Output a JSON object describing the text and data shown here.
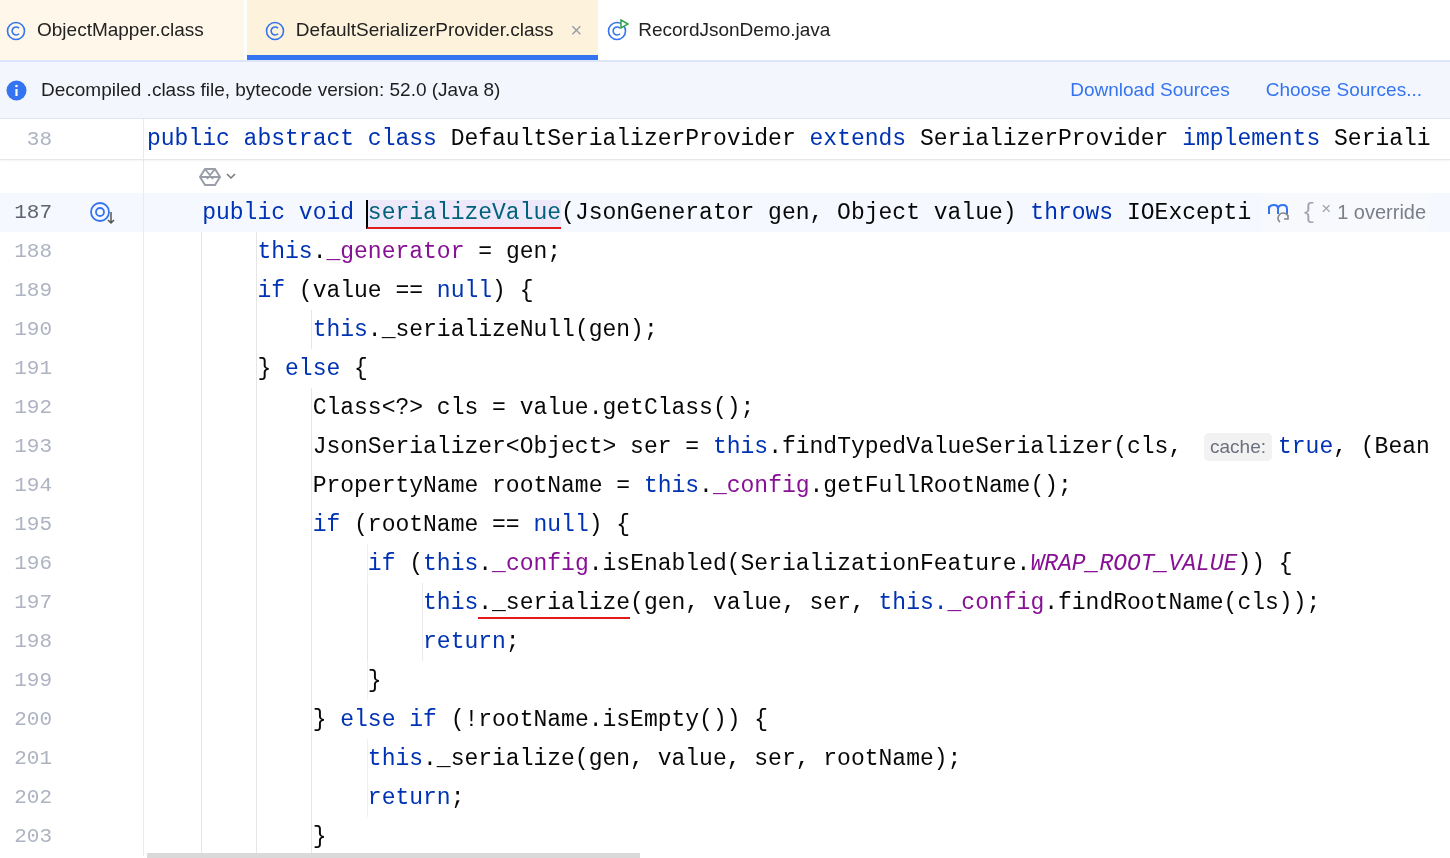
{
  "tabs": [
    {
      "label": "ObjectMapper.class",
      "kind": "class",
      "selected": false
    },
    {
      "label": "DefaultSerializerProvider.class",
      "kind": "class",
      "selected": true,
      "close": "×"
    },
    {
      "label": "RecordJsonDemo.java",
      "kind": "java",
      "selected": false
    }
  ],
  "banner": {
    "message": "Decompiled .class file, bytecode version: 52.0 (Java 8)",
    "links": [
      "Download Sources",
      "Choose Sources..."
    ]
  },
  "editor": {
    "sticky_line": {
      "number": "38",
      "tokens": [
        {
          "kind": "kw",
          "text": "public abstract class"
        },
        {
          "kind": "plain",
          "text": " DefaultSerializerProvider "
        },
        {
          "kind": "kw",
          "text": "extends"
        },
        {
          "kind": "plain",
          "text": " SerializerProvider "
        },
        {
          "kind": "kw",
          "text": "implements"
        },
        {
          "kind": "plain",
          "text": " Seriali"
        }
      ]
    },
    "lines": [
      {
        "number": "187",
        "current": true,
        "override_marker": true,
        "tokens": [
          {
            "kind": "kw",
            "text": "    public void "
          },
          {
            "kind": "method",
            "text": "serializeValue",
            "highlighted": true,
            "caret": true,
            "underlined": true
          },
          {
            "kind": "plain",
            "text": "(JsonGenerator gen, Object value) "
          },
          {
            "kind": "kw",
            "text": "throws"
          },
          {
            "kind": "plain",
            "text": " IOExcepti"
          }
        ],
        "inlay": {
          "brace": "{",
          "close": "×",
          "text": "1 override"
        }
      },
      {
        "number": "188",
        "current": false,
        "tokens": [
          {
            "kind": "kw",
            "text": "        this"
          },
          {
            "kind": "plain",
            "text": "."
          },
          {
            "kind": "field",
            "text": "_generator"
          },
          {
            "kind": "plain",
            "text": " = gen;"
          }
        ]
      },
      {
        "number": "189",
        "current": false,
        "tokens": [
          {
            "kind": "kw",
            "text": "        if"
          },
          {
            "kind": "plain",
            "text": " (value == "
          },
          {
            "kind": "kw",
            "text": "null"
          },
          {
            "kind": "plain",
            "text": ") {"
          }
        ]
      },
      {
        "number": "190",
        "current": false,
        "tokens": [
          {
            "kind": "kw",
            "text": "            this"
          },
          {
            "kind": "plain",
            "text": "._serializeNull(gen);"
          }
        ]
      },
      {
        "number": "191",
        "current": false,
        "tokens": [
          {
            "kind": "plain",
            "text": "        } "
          },
          {
            "kind": "kw",
            "text": "else"
          },
          {
            "kind": "plain",
            "text": " {"
          }
        ]
      },
      {
        "number": "192",
        "current": false,
        "tokens": [
          {
            "kind": "plain",
            "text": "            Class<?> cls = value.getClass();"
          }
        ]
      },
      {
        "number": "193",
        "current": false,
        "tokens": [
          {
            "kind": "plain",
            "text": "            JsonSerializer<Object> ser = "
          },
          {
            "kind": "kw",
            "text": "this"
          },
          {
            "kind": "plain",
            "text": ".findTypedValueSerializer(cls, "
          },
          {
            "kind": "hint",
            "text": "cache:"
          },
          {
            "kind": "kw",
            "text": "true"
          },
          {
            "kind": "plain",
            "text": ", (Bean"
          }
        ]
      },
      {
        "number": "194",
        "current": false,
        "tokens": [
          {
            "kind": "plain",
            "text": "            PropertyName rootName = "
          },
          {
            "kind": "kw",
            "text": "this"
          },
          {
            "kind": "plain",
            "text": "."
          },
          {
            "kind": "field",
            "text": "_config"
          },
          {
            "kind": "plain",
            "text": ".getFullRootName();"
          }
        ]
      },
      {
        "number": "195",
        "current": false,
        "tokens": [
          {
            "kind": "kw",
            "text": "            if"
          },
          {
            "kind": "plain",
            "text": " (rootName == "
          },
          {
            "kind": "kw",
            "text": "null"
          },
          {
            "kind": "plain",
            "text": ") {"
          }
        ]
      },
      {
        "number": "196",
        "current": false,
        "tokens": [
          {
            "kind": "kw",
            "text": "                if"
          },
          {
            "kind": "plain",
            "text": " ("
          },
          {
            "kind": "kw",
            "text": "this"
          },
          {
            "kind": "plain",
            "text": "."
          },
          {
            "kind": "field",
            "text": "_config"
          },
          {
            "kind": "plain",
            "text": ".isEnabled(SerializationFeature."
          },
          {
            "kind": "static",
            "text": "WRAP_ROOT_VALUE"
          },
          {
            "kind": "plain",
            "text": ")) {"
          }
        ]
      },
      {
        "number": "197",
        "current": false,
        "tokens": [
          {
            "kind": "kw",
            "text": "                    this"
          },
          {
            "kind": "plain",
            "text": "._serialize",
            "underlined": true
          },
          {
            "kind": "plain",
            "text": "(gen, value, ser, "
          },
          {
            "kind": "kw",
            "text": "this."
          },
          {
            "kind": "field",
            "text": "_config"
          },
          {
            "kind": "plain",
            "text": ".findRootName(cls));"
          }
        ]
      },
      {
        "number": "198",
        "current": false,
        "tokens": [
          {
            "kind": "kw",
            "text": "                    return"
          },
          {
            "kind": "plain",
            "text": ";"
          }
        ]
      },
      {
        "number": "199",
        "current": false,
        "tokens": [
          {
            "kind": "plain",
            "text": "                }"
          }
        ]
      },
      {
        "number": "200",
        "current": false,
        "tokens": [
          {
            "kind": "plain",
            "text": "            } "
          },
          {
            "kind": "kw",
            "text": "else if"
          },
          {
            "kind": "plain",
            "text": " (!rootName.isEmpty()) {"
          }
        ]
      },
      {
        "number": "201",
        "current": false,
        "tokens": [
          {
            "kind": "kw",
            "text": "                this"
          },
          {
            "kind": "plain",
            "text": "._serialize(gen, value, ser, rootName);"
          }
        ]
      },
      {
        "number": "202",
        "current": false,
        "tokens": [
          {
            "kind": "kw",
            "text": "                return"
          },
          {
            "kind": "plain",
            "text": ";"
          }
        ]
      },
      {
        "number": "203",
        "current": false,
        "tokens": [
          {
            "kind": "plain",
            "text": "            }"
          }
        ]
      }
    ]
  }
}
